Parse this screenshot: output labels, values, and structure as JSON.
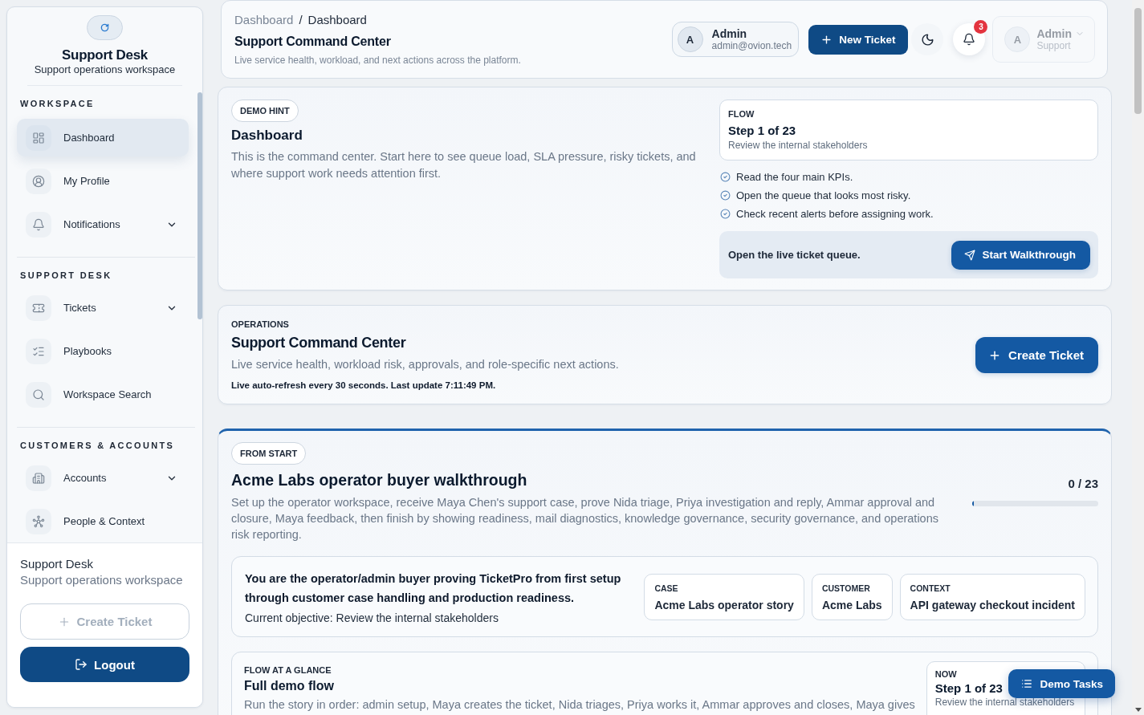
{
  "sidebar": {
    "brand": {
      "title": "Support Desk",
      "subtitle": "Support operations workspace"
    },
    "sections": [
      {
        "label": "WORKSPACE",
        "items": [
          {
            "label": "Dashboard",
            "selected": true,
            "expandable": false
          },
          {
            "label": "My Profile",
            "selected": false,
            "expandable": false
          },
          {
            "label": "Notifications",
            "selected": false,
            "expandable": true
          }
        ]
      },
      {
        "label": "SUPPORT DESK",
        "items": [
          {
            "label": "Tickets",
            "selected": false,
            "expandable": true
          },
          {
            "label": "Playbooks",
            "selected": false,
            "expandable": false
          },
          {
            "label": "Workspace Search",
            "selected": false,
            "expandable": false
          }
        ]
      },
      {
        "label": "CUSTOMERS & ACCOUNTS",
        "items": [
          {
            "label": "Accounts",
            "selected": false,
            "expandable": true
          },
          {
            "label": "People & Context",
            "selected": false,
            "expandable": false
          }
        ]
      }
    ],
    "footer": {
      "title": "Support Desk",
      "subtitle": "Support operations workspace",
      "create_button": {
        "label": "Create Ticket",
        "disabled": true
      },
      "logout_button": {
        "label": "Logout"
      }
    }
  },
  "header": {
    "breadcrumb": {
      "items": [
        "Dashboard",
        "Dashboard"
      ],
      "separator": "/"
    },
    "title": "Support Command Center",
    "subtitle": "Live service health, workload, and next actions across the platform.",
    "user": {
      "avatar": "A",
      "name": "Admin",
      "email": "admin@ovion.tech"
    },
    "new_ticket_button": "New Ticket",
    "notifications": {
      "count": "3"
    },
    "account_menu": {
      "avatar": "A",
      "name": "Admin",
      "role": "Support",
      "disabled": true
    }
  },
  "demo_hint": {
    "tag": "DEMO HINT",
    "title": "Dashboard",
    "text": "This is the command center. Start here to see queue load, SLA pressure, risky tickets, and where support work needs attention first.",
    "flow": {
      "label": "FLOW",
      "step": "Step 1 of 23",
      "description": "Review the internal stakeholders"
    },
    "checklist": [
      "Read the four main KPIs.",
      "Open the queue that looks most risky.",
      "Check recent alerts before assigning work."
    ],
    "action": {
      "text": "Open the live ticket queue.",
      "button": "Start Walkthrough"
    }
  },
  "operations": {
    "eyebrow": "OPERATIONS",
    "title": "Support Command Center",
    "text": "Live service health, workload risk, approvals, and role-specific next actions.",
    "refresh_note": "Live auto-refresh every 30 seconds. Last update 7:11:49 PM.",
    "button": "Create Ticket"
  },
  "walkthrough": {
    "tag": "FROM START",
    "title": "Acme Labs operator buyer walkthrough",
    "text": "Set up the operator workspace, receive Maya Chen's support case, prove Nida triage, Priya investigation and reply, Ammar approval and closure, Maya feedback, then finish by showing readiness, mail diagnostics, knowledge governance, security governance, and operations risk reporting.",
    "progress": {
      "reading": "0 / 23",
      "level": 0
    },
    "persona": {
      "text": "You are the operator/admin buyer proving TicketPro from first setup through customer case handling and production readiness.",
      "objective": "Current objective: Review the internal stakeholders"
    },
    "facts": [
      {
        "label": "CASE",
        "value": "Acme Labs operator story"
      },
      {
        "label": "CUSTOMER",
        "value": "Acme Labs"
      },
      {
        "label": "CONTEXT",
        "value": "API gateway checkout incident"
      }
    ],
    "flow_glance": {
      "eyebrow": "FLOW AT A GLANCE",
      "title": "Full demo flow",
      "text": "Run the story in order: admin setup, Maya creates the ticket, Nida triages, Priya works it, Ammar approves and closes, Maya gives",
      "now": {
        "label": "NOW",
        "step": "Step 1 of 23",
        "description": "Review the internal stakeholders"
      }
    }
  },
  "demo_tasks_button": {
    "label": "Demo Tasks"
  }
}
